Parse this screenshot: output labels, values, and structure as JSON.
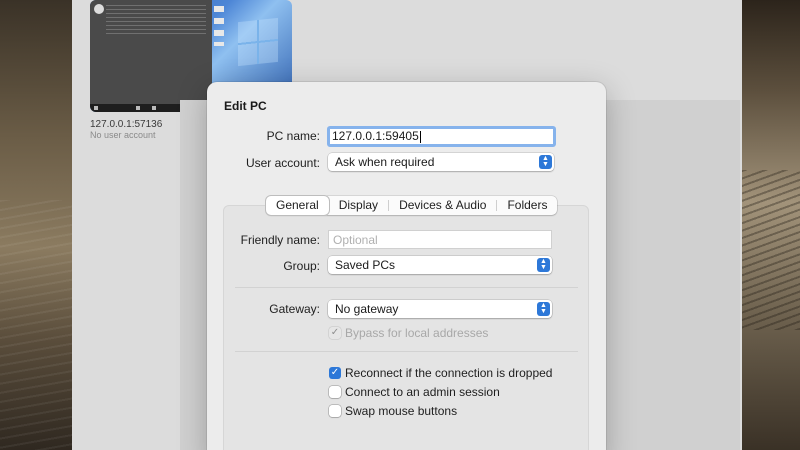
{
  "background_app": {
    "thumbnail_title": "127.0.0.1:57136",
    "thumbnail_subtitle": "No user account"
  },
  "dialog": {
    "title": "Edit PC",
    "pc_name": {
      "label": "PC name:",
      "value": "127.0.0.1:59405"
    },
    "user_account": {
      "label": "User account:",
      "value": "Ask when required"
    },
    "tabs": [
      {
        "label": "General",
        "selected": true
      },
      {
        "label": "Display",
        "selected": false
      },
      {
        "label": "Devices & Audio",
        "selected": false
      },
      {
        "label": "Folders",
        "selected": false
      }
    ],
    "general": {
      "friendly_name": {
        "label": "Friendly name:",
        "placeholder": "Optional",
        "value": ""
      },
      "group": {
        "label": "Group:",
        "value": "Saved PCs"
      },
      "gateway": {
        "label": "Gateway:",
        "value": "No gateway"
      },
      "bypass": {
        "label": "Bypass for local addresses",
        "checked": true,
        "enabled": false
      },
      "options": [
        {
          "label": "Reconnect if the connection is dropped",
          "checked": true
        },
        {
          "label": "Connect to an admin session",
          "checked": false
        },
        {
          "label": "Swap mouse buttons",
          "checked": false
        }
      ]
    }
  },
  "colors": {
    "accent": "#2d78d8",
    "focus_ring": "#86b3ec",
    "sheet_background": "#ececec"
  },
  "icons": {
    "popup_arrows": "chevron-up-down-icon",
    "checkmark": "checkmark-icon"
  }
}
